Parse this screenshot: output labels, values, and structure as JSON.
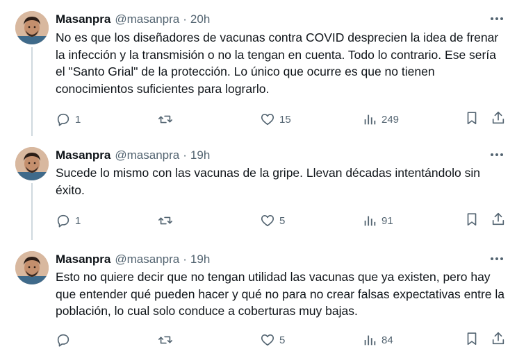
{
  "tweets": [
    {
      "author": "Masanpra",
      "handle": "@masanpra",
      "separator": "·",
      "time": "20h",
      "text": "No es que los diseñadores de vacunas contra COVID desprecien la idea de frenar la infección y la transmisión o no la tengan en cuenta. Todo lo contrario. Ese sería el \"Santo Grial\" de la protección. Lo único que ocurre es que no tienen conocimientos suficientes para lograrlo.",
      "replies": "1",
      "retweets": "",
      "likes": "15",
      "views": "249"
    },
    {
      "author": "Masanpra",
      "handle": "@masanpra",
      "separator": "·",
      "time": "19h",
      "text": "Sucede lo mismo con las vacunas de la gripe. Llevan décadas intentándolo sin éxito.",
      "replies": "1",
      "retweets": "",
      "likes": "5",
      "views": "91"
    },
    {
      "author": "Masanpra",
      "handle": "@masanpra",
      "separator": "·",
      "time": "19h",
      "text": "Esto no quiere decir que no tengan utilidad las vacunas que ya existen, pero hay que entender qué pueden hacer y qué no para no crear falsas expectativas entre la población, lo cual solo conduce a coberturas muy bajas.",
      "replies": "",
      "retweets": "",
      "likes": "5",
      "views": "84"
    }
  ],
  "icons": {
    "reply": "reply-icon",
    "retweet": "retweet-icon",
    "like": "heart-icon",
    "views": "views-icon",
    "bookmark": "bookmark-icon",
    "share": "share-icon",
    "more": "more-icon"
  },
  "colors": {
    "text": "#0f1419",
    "secondary": "#536471",
    "thread_line": "#cfd9de"
  }
}
